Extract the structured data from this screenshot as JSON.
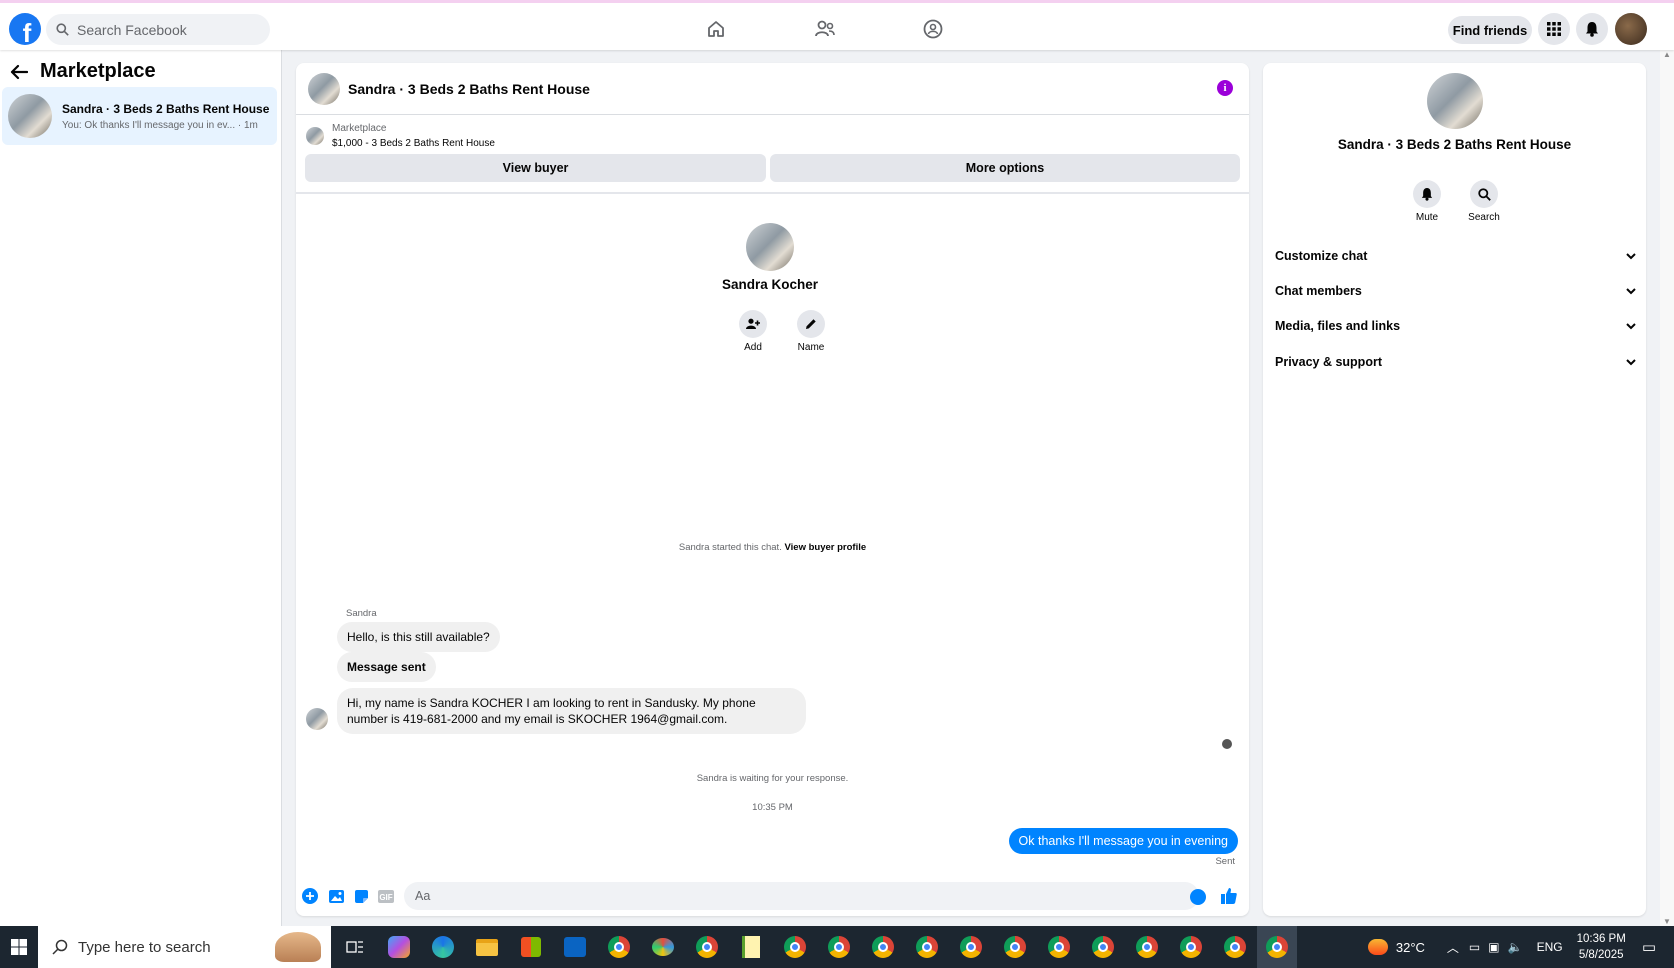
{
  "topbar": {
    "search_placeholder": "Search Facebook",
    "find_friends_label": "Find friends",
    "nav_icons": [
      "home-icon",
      "friends-icon",
      "groups-icon"
    ]
  },
  "sidebar": {
    "title": "Marketplace",
    "conversations": [
      {
        "name": "Sandra · 3 Beds 2 Baths Rent House",
        "preview": "You: Ok thanks I'll message you in ev... · 1m"
      }
    ]
  },
  "chat": {
    "title": "Sandra · 3 Beds 2 Baths Rent House",
    "listing_source": "Marketplace",
    "listing_title": "$1,000 - 3 Beds 2 Baths Rent House",
    "view_buyer_label": "View buyer",
    "more_options_label": "More options",
    "intro_name": "Sandra Kocher",
    "intro_actions": {
      "add": "Add",
      "name": "Name"
    },
    "started_text": "Sandra started this chat.",
    "view_profile_link": "View buyer profile",
    "sender_name": "Sandra",
    "messages_in": [
      "Hello, is this still available?",
      "Message sent",
      "Hi, my name is Sandra KOCHER I am looking to rent in Sandusky. My phone number is 419-681-2000 and my email is SKOCHER 1964@gmail.com."
    ],
    "waiting_text": "Sandra is waiting for your response.",
    "timestamp": "10:35 PM",
    "message_out": "Ok thanks I'll message you in evening",
    "sent_label": "Sent",
    "composer_placeholder": "Aa"
  },
  "right_panel": {
    "title": "Sandra · 3 Beds 2 Baths Rent House",
    "actions": {
      "mute": "Mute",
      "search": "Search"
    },
    "sections": [
      "Customize chat",
      "Chat members",
      "Media, files and links",
      "Privacy & support"
    ]
  },
  "taskbar": {
    "search_placeholder": "Type here to search",
    "weather": "32°C",
    "language": "ENG",
    "time": "10:36 PM",
    "date": "5/8/2025"
  },
  "colors": {
    "brand": "#1877f2",
    "outgoing_bubble": "#0084ff",
    "info_purple": "#9b00d9"
  }
}
